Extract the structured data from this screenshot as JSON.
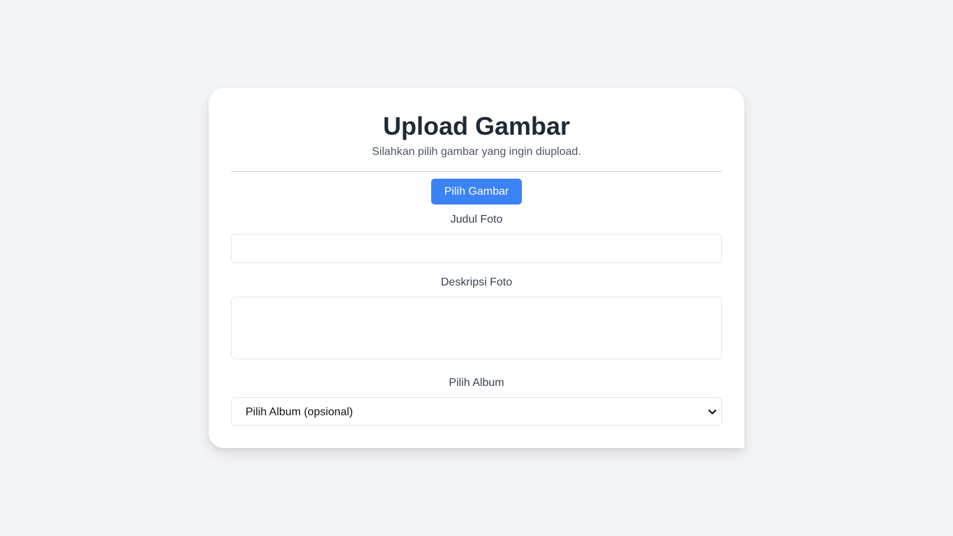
{
  "form": {
    "title": "Upload Gambar",
    "subtitle": "Silahkan pilih gambar yang ingin diupload.",
    "pick_button_label": "Pilih Gambar",
    "title_field": {
      "label": "Judul Foto",
      "value": ""
    },
    "description_field": {
      "label": "Deskripsi Foto",
      "value": ""
    },
    "album_field": {
      "label": "Pilih Album",
      "selected": "Pilih Album (opsional)"
    }
  },
  "icons": {
    "album_select_indicator": "chevron-down-icon"
  },
  "colors": {
    "page_background": "#f3f4f6",
    "card_background": "#ffffff",
    "primary_button": "#3b82f6",
    "title_text": "#1f2937"
  }
}
